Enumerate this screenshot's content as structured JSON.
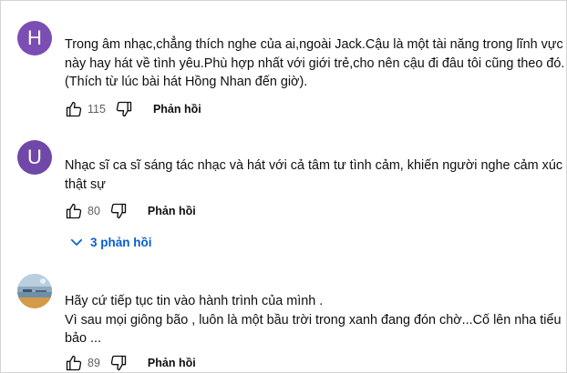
{
  "comments": [
    {
      "avatar_letter": "H",
      "avatar_color": "#7b4eb3",
      "lines": [
        "Trong âm nhạc,chẳng thích nghe của ai,ngoài Jack.Cậu là một tài năng trong lĩnh vực",
        "này hay hát về tình yêu.Phù hợp nhất với giới trẻ,cho nên cậu đi đâu tôi cũng theo đó.",
        "(Thích từ lúc bài hát Hồng Nhan đến giờ)."
      ],
      "like_count": "115",
      "reply_label": "Phản hồi"
    },
    {
      "avatar_letter": "U",
      "avatar_color": "#6f48a8",
      "lines": [
        "Nhạc sĩ ca sĩ sáng tác nhạc và hát với cả tâm tư tình cảm, khiến người nghe cảm xúc",
        "thật sự"
      ],
      "like_count": "80",
      "reply_label": "Phản hồi",
      "replies_toggle": "3 phản hồi"
    },
    {
      "avatar_letter": "",
      "avatar_color": "#9fb7c9",
      "lines": [
        "Hãy cứ tiếp tục tin vào hành trình của mình .",
        "Vì sau mọi giông bão , luôn là một bầu trời trong xanh đang đón chờ...Cố lên nha tiểu",
        "bảo ..."
      ],
      "like_count": "89",
      "reply_label": "Phản hồi"
    }
  ],
  "icons": {
    "like": "thumbs-up-icon",
    "dislike": "thumbs-down-icon",
    "expand": "chevron-down-icon"
  },
  "colors": {
    "link_blue": "#065fd4",
    "meta_gray": "#606060"
  }
}
